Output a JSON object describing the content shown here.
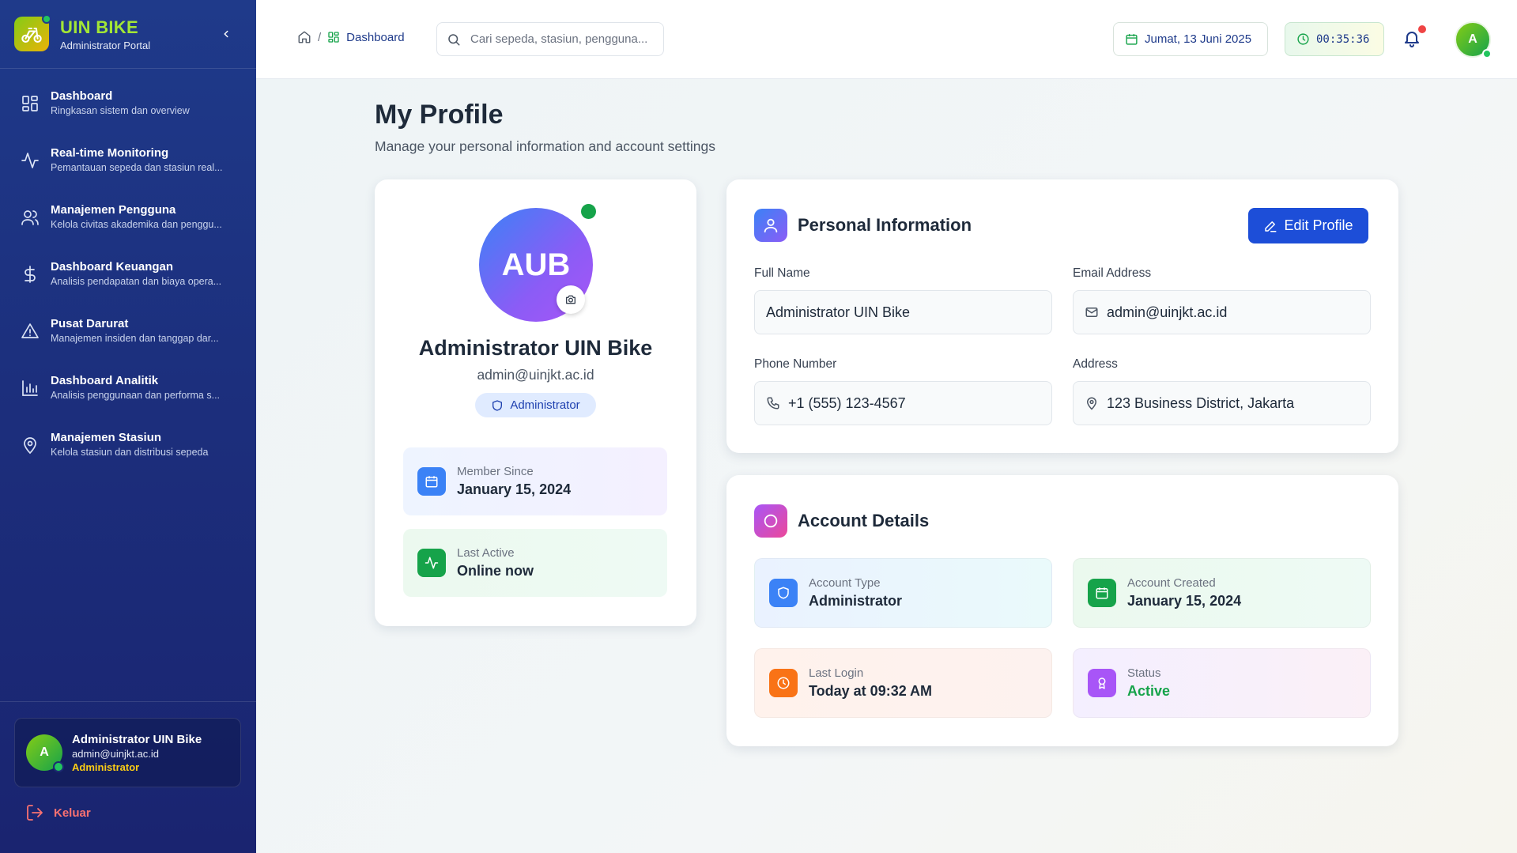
{
  "app": {
    "title": "UIN BIKE",
    "subtitle": "Administrator Portal"
  },
  "sidebar": {
    "items": [
      {
        "label": "Dashboard",
        "desc": "Ringkasan sistem dan overview",
        "icon": "grid-icon"
      },
      {
        "label": "Real-time Monitoring",
        "desc": "Pemantauan sepeda dan stasiun real...",
        "icon": "activity-icon"
      },
      {
        "label": "Manajemen Pengguna",
        "desc": "Kelola civitas akademika dan penggu...",
        "icon": "users-icon"
      },
      {
        "label": "Dashboard Keuangan",
        "desc": "Analisis pendapatan dan biaya opera...",
        "icon": "dollar-icon"
      },
      {
        "label": "Pusat Darurat",
        "desc": "Manajemen insiden dan tanggap dar...",
        "icon": "alert-icon"
      },
      {
        "label": "Dashboard Analitik",
        "desc": "Analisis penggunaan dan performa s...",
        "icon": "bar-chart-icon"
      },
      {
        "label": "Manajemen Stasiun",
        "desc": "Kelola stasiun dan distribusi sepeda",
        "icon": "map-pin-icon"
      }
    ],
    "user": {
      "initial": "A",
      "name": "Administrator UIN Bike",
      "email": "admin@uinjkt.ac.id",
      "role": "Administrator"
    },
    "logout_label": "Keluar"
  },
  "header": {
    "breadcrumb_sep": "/",
    "breadcrumb_current": "Dashboard",
    "search_placeholder": "Cari sepeda, stasiun, pengguna...",
    "date": "Jumat, 13 Juni 2025",
    "time": "00:35:36",
    "avatar_initial": "A"
  },
  "page": {
    "title": "My Profile",
    "subtitle": "Manage your personal information and account settings"
  },
  "profile": {
    "initials": "AUB",
    "name": "Administrator UIN Bike",
    "email": "admin@uinjkt.ac.id",
    "role": "Administrator",
    "member_since_label": "Member Since",
    "member_since": "January 15, 2024",
    "last_active_label": "Last Active",
    "last_active": "Online now"
  },
  "personal_info": {
    "title": "Personal Information",
    "edit_label": "Edit Profile",
    "full_name_label": "Full Name",
    "full_name": "Administrator UIN Bike",
    "email_label": "Email Address",
    "email": "admin@uinjkt.ac.id",
    "phone_label": "Phone Number",
    "phone": "+1 (555) 123-4567",
    "address_label": "Address",
    "address": "123 Business District, Jakarta"
  },
  "account_details": {
    "title": "Account Details",
    "type_label": "Account Type",
    "type": "Administrator",
    "created_label": "Account Created",
    "created": "January 15, 2024",
    "last_login_label": "Last Login",
    "last_login": "Today at 09:32 AM",
    "status_label": "Status",
    "status": "Active"
  },
  "colors": {
    "sidebar": "#1f3a8a",
    "brand_accent": "#a3e635",
    "primary": "#1d4ed8",
    "success": "#16a34a",
    "danger": "#ef4444"
  }
}
